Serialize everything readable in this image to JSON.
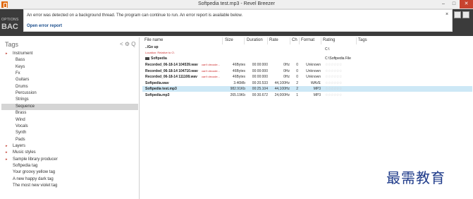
{
  "window": {
    "title": "Softpedia test.mp3 - Revel Breezer",
    "minimize": "–",
    "maximize": "□",
    "close": "✕"
  },
  "header": {
    "options_label": "OPTIONS",
    "back_label": "BAC"
  },
  "error_bar": {
    "message": "An error was detected on a background thread. The program can continue to run. An error report is available below.",
    "link": "Open error report",
    "close": "×"
  },
  "tags_panel": {
    "title": "Tags",
    "tools": "< ⚙ Q",
    "items": [
      {
        "label": "Instrument",
        "indent": 0,
        "arrow": true
      },
      {
        "label": "Bass",
        "indent": 1
      },
      {
        "label": "Keys",
        "indent": 1
      },
      {
        "label": "Fx",
        "indent": 1
      },
      {
        "label": "Guitars",
        "indent": 1
      },
      {
        "label": "Drums",
        "indent": 1
      },
      {
        "label": "Percussion",
        "indent": 1
      },
      {
        "label": "Strings",
        "indent": 1
      },
      {
        "label": "Sequence",
        "indent": 1,
        "selected": true
      },
      {
        "label": "Brass",
        "indent": 1
      },
      {
        "label": "Wind",
        "indent": 1
      },
      {
        "label": "Vocals",
        "indent": 1
      },
      {
        "label": "Synth",
        "indent": 1
      },
      {
        "label": "Pads",
        "indent": 1
      },
      {
        "label": "Layers",
        "indent": 0,
        "arrow": true
      },
      {
        "label": "Music styles",
        "indent": 0,
        "arrow": true
      },
      {
        "label": "Sample library producer",
        "indent": 0,
        "arrow": true
      },
      {
        "label": "Softpedia tag",
        "indent": 0
      },
      {
        "label": "Your groovy yellow tag",
        "indent": 0
      },
      {
        "label": "A new happy dark tag",
        "indent": 0
      },
      {
        "label": "The most new violet tag",
        "indent": 0
      }
    ]
  },
  "file_table": {
    "columns": [
      "File name",
      "Size",
      "Duration",
      "Rate",
      "Ch",
      "Format",
      "Rating",
      "Tags"
    ],
    "go_up": "..\\Go up",
    "go_up_sub": "Location: Relative to C\\",
    "go_up_rating": "C:\\",
    "folder_name": "Softpedia",
    "folder_rating": "C:\\Softpedia File",
    "rows": [
      {
        "name": "Recorded_06-18-14 104539.wav",
        "size": "46Bytes",
        "duration": "00:00:000",
        "rate": "0Hz",
        "ch": "0",
        "format": "Unknown",
        "flag": "can't decode..."
      },
      {
        "name": "Recorded_06-18-14 104710.wav",
        "size": "46Bytes",
        "duration": "00:00:000",
        "rate": "0Hz",
        "ch": "0",
        "format": "Unknown",
        "flag": "can't decode..."
      },
      {
        "name": "Recorded_06-18-14 111108.wav",
        "size": "46Bytes",
        "duration": "00:00:000",
        "rate": "0Hz",
        "ch": "0",
        "format": "Unknown",
        "flag": "can't decode..."
      },
      {
        "name": "Softpedia.wav",
        "size": "3.46Mb",
        "duration": "00:20.533",
        "rate": "44,100Hz",
        "ch": "2",
        "format": "WAVE",
        "flag": ""
      },
      {
        "name": "Softpedia test.mp3",
        "size": "982.91Kb",
        "duration": "00:25.104",
        "rate": "44,100Hz",
        "ch": "2",
        "format": "MP3",
        "flag": "",
        "selected": true
      },
      {
        "name": "Softpedia.mp3",
        "size": "265.19Kb",
        "duration": "00:30.672",
        "rate": "24,000Hz",
        "ch": "1",
        "format": "MP3",
        "flag": ""
      }
    ],
    "stars": "☆☆☆☆☆☆"
  },
  "watermark": "最需教育",
  "colors": {
    "accent_orange": "#e06b10",
    "header_dark": "#3b3b3b",
    "selection_blue": "#cde8f6",
    "selection_grey": "#d5d5d5",
    "error_red": "#cc2a2a",
    "watermark_blue": "#1f3b8a"
  }
}
